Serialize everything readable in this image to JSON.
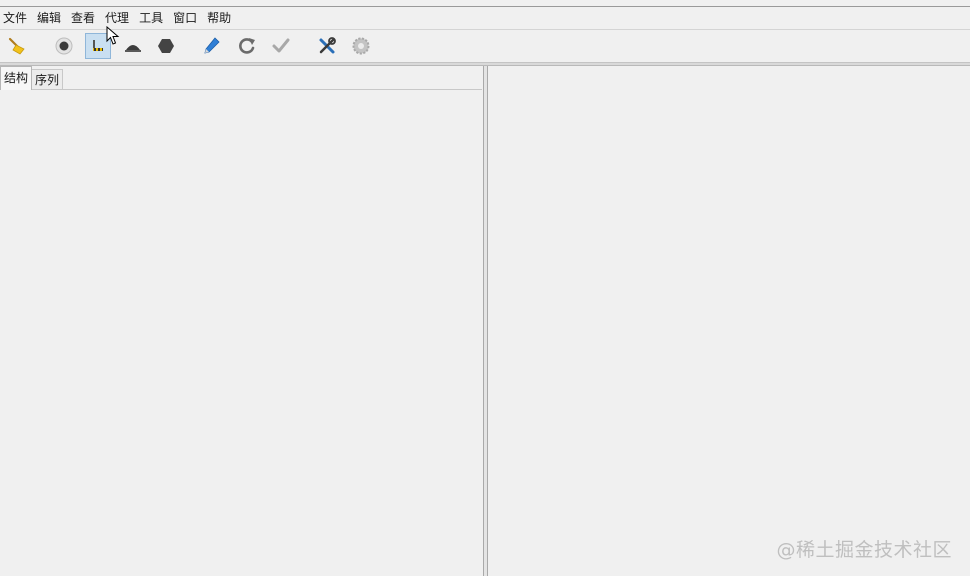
{
  "menubar": {
    "items": [
      "文件",
      "编辑",
      "查看",
      "代理",
      "工具",
      "窗口",
      "帮助"
    ]
  },
  "toolbar": {
    "buttons": [
      {
        "icon": "broom-icon",
        "active": false
      },
      {
        "icon": "record-icon",
        "active": false
      },
      {
        "icon": "throttle-icon",
        "active": true
      },
      {
        "icon": "turtle-icon",
        "active": false
      },
      {
        "icon": "stop-hexagon-icon",
        "active": false
      },
      {
        "icon": "pen-icon",
        "active": false
      },
      {
        "icon": "repeat-icon",
        "active": false
      },
      {
        "icon": "validate-check-icon",
        "active": false
      },
      {
        "icon": "tools-icon",
        "active": false
      },
      {
        "icon": "settings-gear-icon",
        "active": false
      }
    ]
  },
  "left_pane": {
    "tabs": [
      {
        "label": "结构",
        "active": true
      },
      {
        "label": "序列",
        "active": false
      }
    ]
  },
  "watermark": "@稀土掘金技术社区",
  "colors": {
    "background": "#f0f0f0",
    "active_button": "#c9dff1",
    "watermark": "#bfbfbf"
  }
}
